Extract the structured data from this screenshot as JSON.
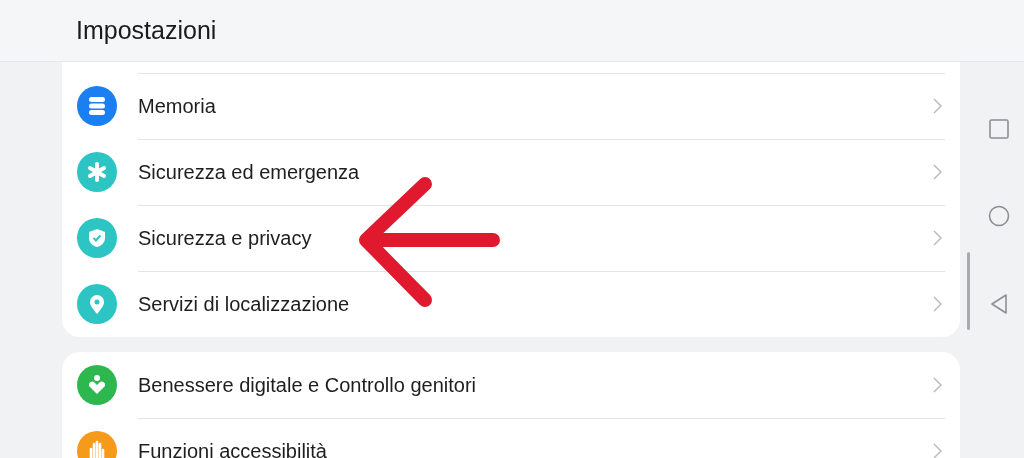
{
  "header": {
    "title": "Impostazioni"
  },
  "sections": [
    {
      "items": [
        {
          "label": "Memoria",
          "kind": "storage",
          "color": "#1a7ff0"
        },
        {
          "label": "Sicurezza ed emergenza",
          "kind": "asterisk",
          "color": "#2cc5c3"
        },
        {
          "label": "Sicurezza e privacy",
          "kind": "shield",
          "color": "#2cc5c3"
        },
        {
          "label": "Servizi di localizzazione",
          "kind": "pin",
          "color": "#2cc5c3"
        }
      ]
    },
    {
      "items": [
        {
          "label": "Benessere digitale e Controllo genitori",
          "kind": "heart",
          "color": "#2db84f"
        },
        {
          "label": "Funzioni accessibilità",
          "kind": "hand",
          "color": "#f59a1b"
        }
      ]
    }
  ]
}
